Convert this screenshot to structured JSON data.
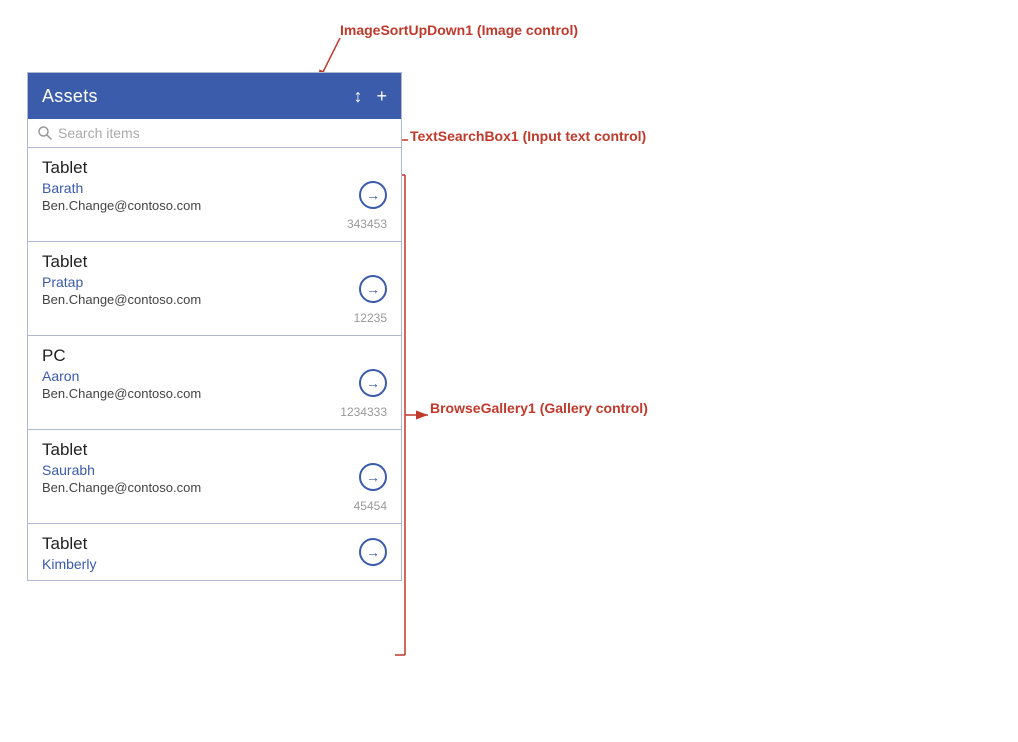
{
  "header": {
    "title": "Assets",
    "sort_icon": "↕",
    "add_icon": "+"
  },
  "search": {
    "placeholder": "Search items"
  },
  "gallery": {
    "items": [
      {
        "title": "Tablet",
        "subtitle": "Barath",
        "email": "Ben.Change@contoso.com",
        "number": "343453"
      },
      {
        "title": "Tablet",
        "subtitle": "Pratap",
        "email": "Ben.Change@contoso.com",
        "number": "12235"
      },
      {
        "title": "PC",
        "subtitle": "Aaron",
        "email": "Ben.Change@contoso.com",
        "number": "1234333"
      },
      {
        "title": "Tablet",
        "subtitle": "Saurabh",
        "email": "Ben.Change@contoso.com",
        "number": "45454"
      },
      {
        "title": "Tablet",
        "subtitle": "Kimberly",
        "email": "",
        "number": ""
      }
    ]
  },
  "annotations": {
    "top_label": "ImageSortUpDown1 (Image control)",
    "search_label": "TextSearchBox1 (Input text control)",
    "gallery_label": "BrowseGallery1 (Gallery control)"
  }
}
